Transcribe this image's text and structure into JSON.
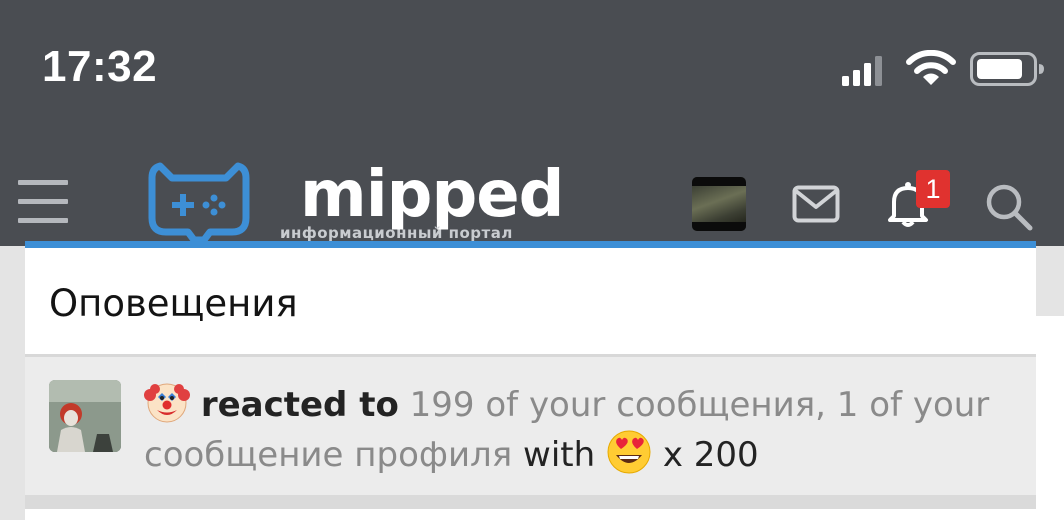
{
  "status_bar": {
    "time": "17:32",
    "icons": [
      "signal-icon",
      "wifi-icon",
      "battery-icon"
    ]
  },
  "header": {
    "menu_icon": "hamburger-menu-icon",
    "logo": {
      "name": "mipped",
      "subtitle": "информационный портал",
      "icon": "gamepad-icon",
      "color": "#3d8fd6"
    },
    "icons": [
      "user-avatar",
      "mail-icon",
      "bell-icon",
      "search-icon"
    ],
    "notification_badge": "1",
    "badge_color": "#e0322f"
  },
  "notifications": {
    "title": "Оповещения",
    "accent_color": "#3d8fd6",
    "items": [
      {
        "emoji_icon": "clown-face-emoji",
        "action": "reacted to",
        "target": "199 of your сообщения, 1 of your сообщение профиля",
        "with_label": "with",
        "reaction_emoji": "heart-eyes-emoji",
        "count": "x 200"
      }
    ]
  }
}
